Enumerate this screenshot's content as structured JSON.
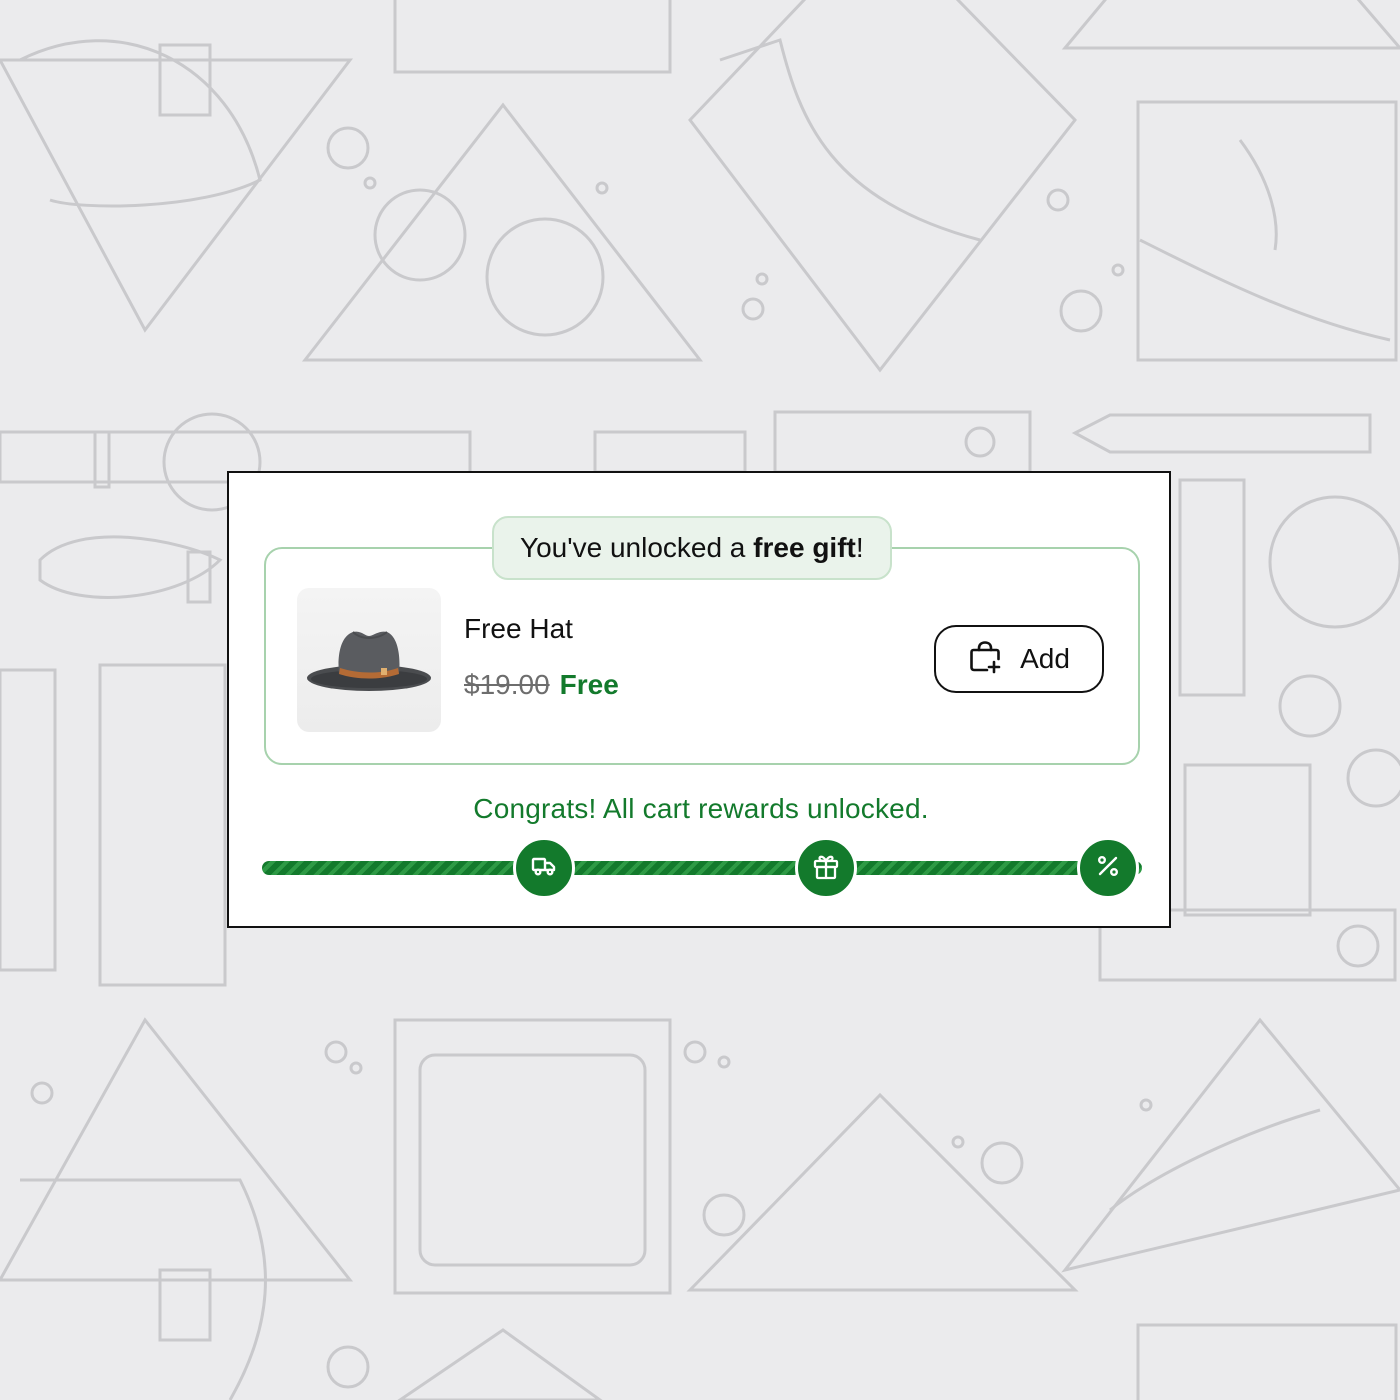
{
  "gift_banner": {
    "text_prefix": "You've unlocked a ",
    "text_bold": "free gift",
    "text_suffix": "!"
  },
  "gift_item": {
    "image_icon": "hat-product-image",
    "name": "Free Hat",
    "original_price": "$19.00",
    "sale_price": "Free",
    "add_button": {
      "icon": "bag-plus-icon",
      "label": "Add"
    }
  },
  "rewards": {
    "status_text": "Congrats! All cart rewards unlocked.",
    "progress": 1.0,
    "milestones": [
      {
        "icon": "truck-icon",
        "unlocked": true
      },
      {
        "icon": "gift-icon",
        "unlocked": true
      },
      {
        "icon": "percent-icon",
        "unlocked": true
      }
    ]
  },
  "colors": {
    "accent_green": "#137a2c",
    "border_green": "#a7d2ad",
    "pill_bg": "#eaf3eb",
    "background": "#ebebed"
  }
}
